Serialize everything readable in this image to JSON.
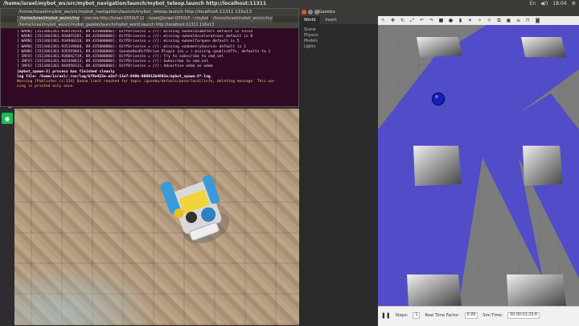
{
  "topbar": {
    "title": "/home/israel/mybot_ws/src/mybot_navigation/launch/mybot_teleop.launch http://localhost:11311",
    "tray": [
      "En",
      "◀))",
      "18:04",
      "⚙"
    ]
  },
  "launcher": {
    "icons": [
      {
        "name": "search-icon",
        "glyph": "⌕",
        "color": "#5e2750"
      },
      {
        "name": "files-icon",
        "glyph": "▤",
        "color": "#6d6d6d"
      },
      {
        "name": "firefox-icon",
        "glyph": "●",
        "color": "#e66000"
      },
      {
        "name": "libreoffice-icon",
        "glyph": "▦",
        "color": "#1f7a34"
      },
      {
        "name": "software-center-icon",
        "glyph": "A",
        "color": "#c9461c"
      },
      {
        "name": "settings-icon",
        "glyph": "⚙",
        "color": "#555"
      },
      {
        "name": "terminal-icon",
        "glyph": ">_",
        "color": "#222"
      },
      {
        "name": "spotify-icon",
        "glyph": "◉",
        "color": "#1db954"
      }
    ]
  },
  "terminal": {
    "title": "/home/israel/mybot_ws/src/mybot_navigation/launch/mybot_teleop.launch http://localhost:11311 116x13",
    "tabs": [
      "/home/israel/mybot_ws/src/mybot_navig",
      "roscore http://israel-Q550LF:11311/",
      "israel@israel-Q550LF: ~/mybot_ws",
      "/home/israel/mybot_ws/src/mybot_gazebo/launch/mybot_world.launch http://localhost:11311 116x13"
    ],
    "subtitle": "/home/israel/mybot_ws/src/mybot_gazebo/launch/mybot_world.launch http://localhost:11311 116x13",
    "lines": [
      {
        "text": "[ WARN] [1513461361.934574154, 89.435000000]: DiffDrive(ns = //): missing <wheelDiameter> default is False",
        "style": "warn"
      },
      {
        "text": "[ WARN] [1513461361.934855265, 89.435000000]: DiffDrive(ns = //): missing <wheelAcceleration> default is 0",
        "style": "warn"
      },
      {
        "text": "[ WARN] [1513461361.934940328, 89.435000000]: DiffDrive(ns = //): missing <wheelTorque> default is 5",
        "style": "warn"
      },
      {
        "text": "[ WARN] [1513461361.935149668, 89.435000000]: DiffDrive(ns = //): missing <odometrySource> default is 1",
        "style": "warn"
      },
      {
        "text": "[ WARN] [1513461361.935593843, 89.435000000]: GazeboRosDiffDrive Plugin (ns = ) missing <publishTf>, defaults to 1",
        "style": "warn"
      },
      {
        "text": "[ INFO] [1513461361.936842719, 89.435000000]: DiffDrive(ns = //): Try to subscribe to cmd_vel",
        "style": "warn"
      },
      {
        "text": "[ INFO] [1513461361.942448613, 89.435000000]: DiffDrive(ns = //): Subscribe to cmd_vel",
        "style": "warn"
      },
      {
        "text": "[ INFO] [1513461361.944950131, 89.435000000]: DiffDrive(ns = //): Advertise odom on odom",
        "style": "warn"
      },
      {
        "text": "[mybot_spawn-3] process has finished cleanly",
        "style": "strong"
      },
      {
        "text": "log file: /home/israel/.ros/log/b79a423e-e2af-11e7-848b-008012b4682e/mybot_spawn-3*.log",
        "style": "strong"
      },
      {
        "text": "Warning [Publisher.cc:134] Queue limit reached for topic /gazebo/default/pose/local/info, deleting message. This war",
        "style": "err"
      },
      {
        "text": "ning is printed only once.",
        "style": "err"
      }
    ]
  },
  "gazebo": {
    "window_title": "Gazebo",
    "left_tabs": [
      "World",
      "Insert"
    ],
    "tree": [
      "Scene",
      "Physics",
      "Models",
      "Lights"
    ],
    "status": {
      "steps_label": "Steps:",
      "steps_value": "1",
      "rtf_label": "Real Time Factor:",
      "rtf_value": "0.99",
      "sim_time_label": "Sim Time:",
      "sim_time_value": "00 00:01:29.8"
    }
  }
}
